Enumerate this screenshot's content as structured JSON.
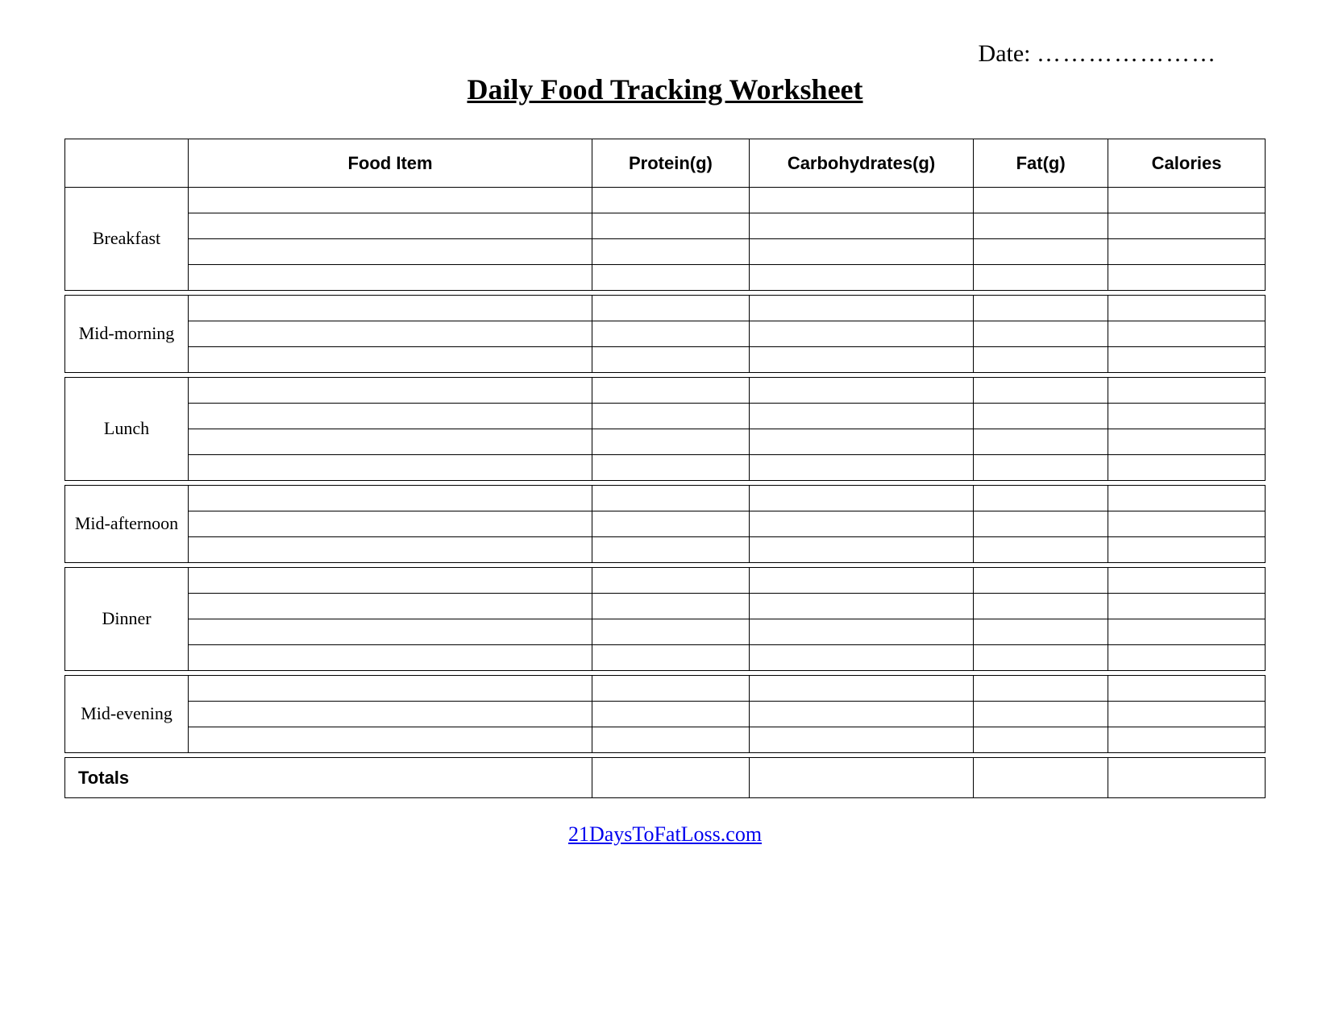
{
  "header": {
    "date_label": "Date:",
    "date_value": "…………………",
    "title": "Daily Food Tracking Worksheet"
  },
  "columns": {
    "meal": "",
    "food_item": "Food Item",
    "protein": "Protein(g)",
    "carbs": "Carbohydrates(g)",
    "fat": "Fat(g)",
    "calories": "Calories"
  },
  "meals": [
    {
      "label": "Breakfast",
      "rows": 4
    },
    {
      "label": "Mid-morning",
      "rows": 3
    },
    {
      "label": "Lunch",
      "rows": 4
    },
    {
      "label": "Mid-afternoon",
      "rows": 3
    },
    {
      "label": "Dinner",
      "rows": 4
    },
    {
      "label": "Mid-evening",
      "rows": 3
    }
  ],
  "totals_label": "Totals",
  "footer": {
    "link_text": "21DaysToFatLoss.com"
  }
}
